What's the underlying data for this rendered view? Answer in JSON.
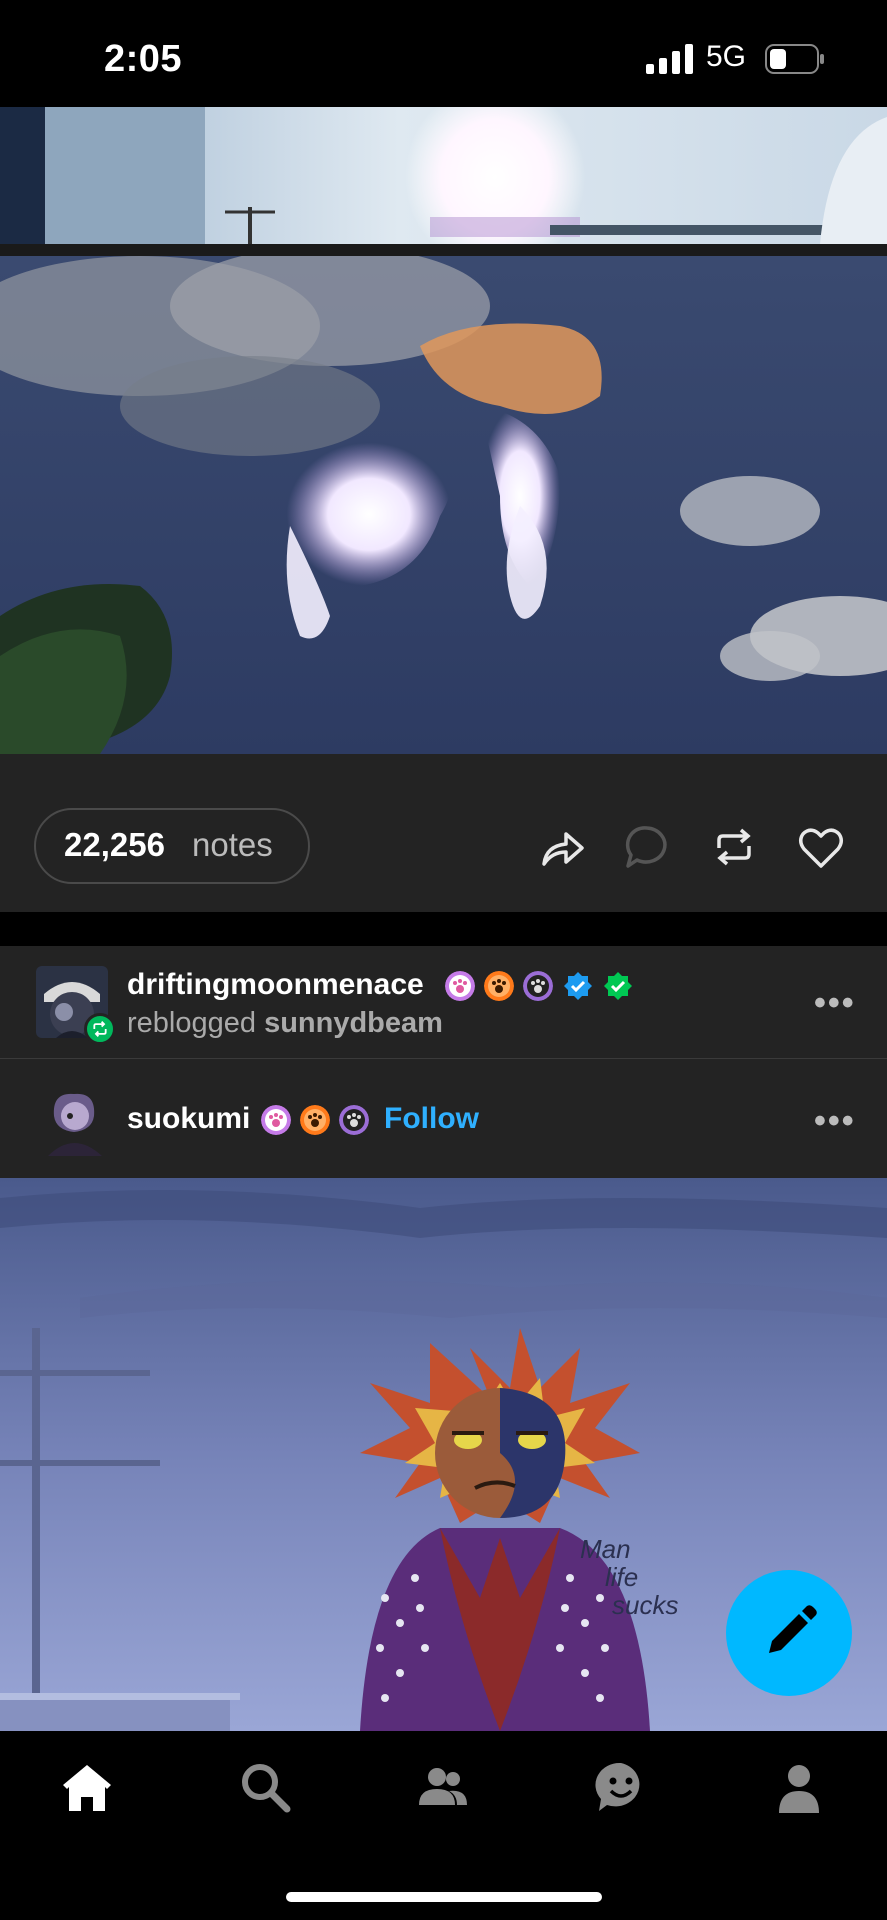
{
  "status_bar": {
    "time": "2:05",
    "network": "5G"
  },
  "post1": {
    "notes_count": "22,256",
    "notes_label": "notes",
    "actions": [
      "share-icon",
      "reply-icon",
      "reblog-icon",
      "like-icon"
    ]
  },
  "post2": {
    "reblogger": {
      "name": "driftingmoonmenace",
      "reblog_verb": "reblogged",
      "source": "sunnydbeam"
    },
    "author": {
      "name": "suokumi",
      "follow_label": "Follow"
    },
    "more_label": "•••",
    "art_caption": [
      "Man",
      "life",
      "sucks"
    ]
  },
  "tab_bar": {
    "tabs": [
      "home-icon",
      "search-icon",
      "communities-icon",
      "activity-icon",
      "account-icon"
    ]
  },
  "colors": {
    "accent": "#00b8ff",
    "follow": "#2fb0ff",
    "reblog_green": "#00b85c",
    "panel": "#232323"
  }
}
